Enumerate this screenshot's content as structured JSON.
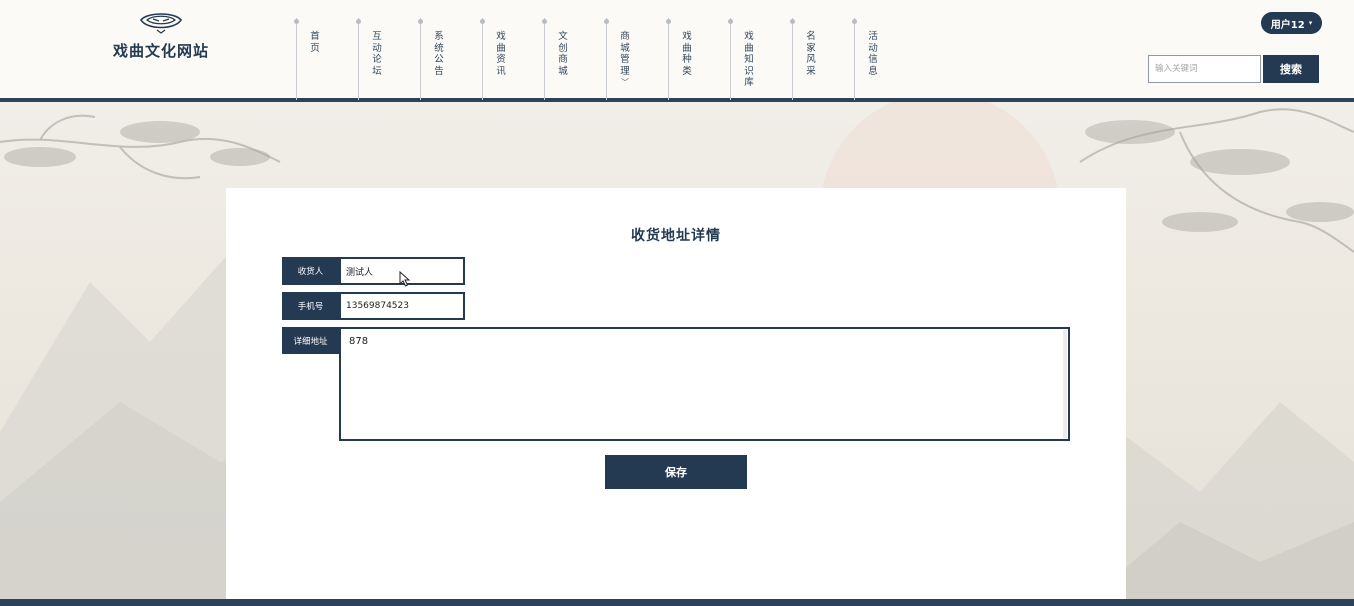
{
  "site": {
    "title": "戏曲文化网站"
  },
  "nav": {
    "items": [
      {
        "label": "首页"
      },
      {
        "label": "互动论坛"
      },
      {
        "label": "系统公告"
      },
      {
        "label": "戏曲资讯"
      },
      {
        "label": "文创商城"
      },
      {
        "label": "商城管理",
        "has_dropdown": true,
        "caret": "﹀"
      },
      {
        "label": "戏曲种类"
      },
      {
        "label": "戏曲知识库"
      },
      {
        "label": "名家风采"
      },
      {
        "label": "活动信息"
      }
    ]
  },
  "user": {
    "name": "用户12",
    "dropdown_icon": "caret-down-icon",
    "caret": "▾"
  },
  "search": {
    "placeholder": "输入关键词",
    "button_label": "搜索"
  },
  "form": {
    "title": "收货地址详情",
    "fields": {
      "recipient": {
        "label": "收货人",
        "value": "测试人"
      },
      "phone": {
        "label": "手机号",
        "value": "13569874523"
      },
      "address": {
        "label": "详细地址",
        "value": "878"
      }
    },
    "save_label": "保存"
  },
  "colors": {
    "primary": "#243a52",
    "header_bg": "#fbfaf6",
    "page_bg": "#efece5",
    "card_bg": "#ffffff"
  }
}
